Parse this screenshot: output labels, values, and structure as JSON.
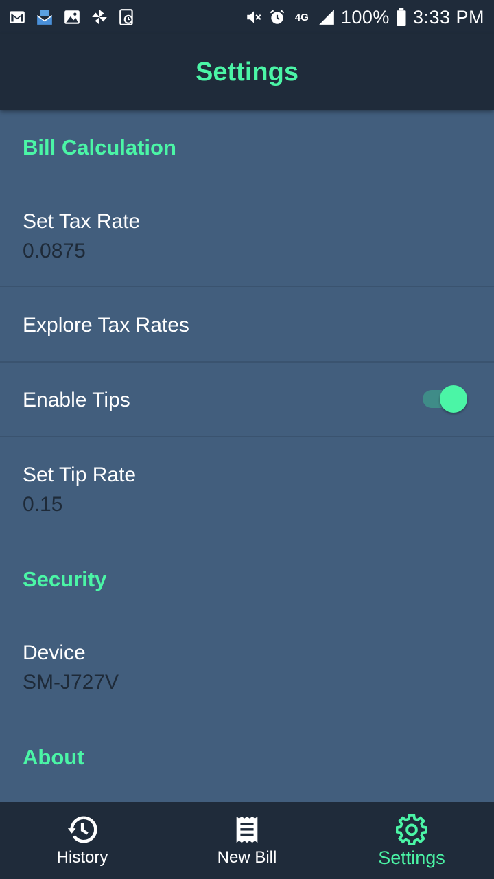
{
  "status_bar": {
    "left_icons": [
      "gmail-icon",
      "mail-icon",
      "gallery-icon",
      "pinwheel-icon",
      "sync-icon"
    ],
    "right_icons": [
      "mute-icon",
      "alarm-icon",
      "lte-icon",
      "signal-icon",
      "battery-icon"
    ],
    "network": "4G",
    "battery": "100%",
    "time": "3:33 PM"
  },
  "app_bar": {
    "title": "Settings"
  },
  "sections": {
    "bill_calculation": {
      "header": "Bill Calculation",
      "set_tax_rate": {
        "title": "Set Tax Rate",
        "summary": "0.0875"
      },
      "explore_tax_rates": {
        "title": "Explore Tax Rates"
      },
      "enable_tips": {
        "title": "Enable Tips",
        "enabled": true
      },
      "set_tip_rate": {
        "title": "Set Tip Rate",
        "summary": "0.15"
      }
    },
    "security": {
      "header": "Security",
      "device": {
        "title": "Device",
        "summary": "SM-J727V"
      }
    },
    "about": {
      "header": "About"
    }
  },
  "bottom_nav": {
    "items": [
      {
        "label": "History",
        "icon": "history-icon",
        "active": false
      },
      {
        "label": "New Bill",
        "icon": "receipt-icon",
        "active": false
      },
      {
        "label": "Settings",
        "icon": "gear-icon",
        "active": true
      }
    ]
  },
  "colors": {
    "accent": "#4bf5a6",
    "bar_background": "#1f2b3a",
    "content_background": "#425e7d",
    "summary_text": "#1e2a38"
  }
}
